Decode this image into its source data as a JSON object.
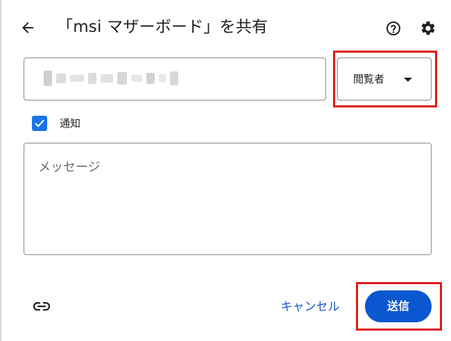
{
  "header": {
    "title": "「msi マザーボード」を共有",
    "back_icon": "arrow-left-icon",
    "help_icon": "help-circle-icon",
    "settings_icon": "gear-icon"
  },
  "people_input": {
    "value": "",
    "redacted": true
  },
  "role_select": {
    "selected": "閲覧者",
    "icon": "caret-down-icon"
  },
  "notify": {
    "label": "通知",
    "checked": true
  },
  "message": {
    "placeholder": "メッセージ",
    "value": ""
  },
  "footer": {
    "link_icon": "link-icon",
    "cancel_label": "キャンセル",
    "send_label": "送信"
  },
  "colors": {
    "accent": "#0b57d0",
    "checkbox": "#1a73e8",
    "highlight": "#e01818",
    "link_text": "#1a56c4"
  }
}
